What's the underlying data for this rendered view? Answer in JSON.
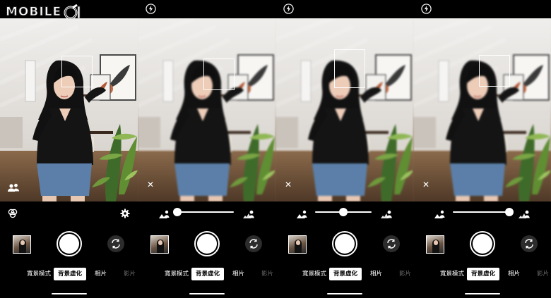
{
  "logo": {
    "text": "MOBILE",
    "mark_icon": "wrench-o1-logo"
  },
  "panels": [
    {
      "id": "panel-0",
      "status": {
        "flash_icon": "flash-auto-icon"
      },
      "viewfinder": {
        "blurred": false,
        "overlay_icon": "people-portrait-icon"
      },
      "controls": {
        "show_slider": false,
        "left_icon": "filter-icon",
        "right_icon": "gear-icon"
      },
      "shutter_icon": "shutter-button",
      "switch_icon": "switch-camera-icon",
      "modes": {
        "portrait": "寬景模式",
        "bokeh": "背景虛化",
        "photo": "相片",
        "video": "影片"
      }
    },
    {
      "id": "panel-1",
      "status": {
        "flash_icon": "flash-auto-icon"
      },
      "viewfinder": {
        "blurred": true,
        "overlay_icon": "close-icon",
        "close_glyph": "✕"
      },
      "controls": {
        "show_slider": true,
        "blur_level": 0.0
      },
      "modes": {
        "portrait": "寬景模式",
        "bokeh": "背景虛化",
        "photo": "相片",
        "video": "影片"
      }
    },
    {
      "id": "panel-2",
      "status": {
        "flash_icon": "flash-auto-icon"
      },
      "viewfinder": {
        "blurred": true,
        "overlay_icon": "close-icon",
        "close_glyph": "✕"
      },
      "controls": {
        "show_slider": true,
        "blur_level": 0.5
      },
      "modes": {
        "portrait": "寬景模式",
        "bokeh": "背景虛化",
        "photo": "相片",
        "video": "影片"
      }
    },
    {
      "id": "panel-3",
      "status": {
        "flash_icon": "flash-auto-icon"
      },
      "viewfinder": {
        "blurred": true,
        "overlay_icon": "close-icon",
        "close_glyph": "✕"
      },
      "controls": {
        "show_slider": true,
        "blur_level": 1.0
      },
      "modes": {
        "portrait": "寬景模式",
        "bokeh": "背景虛化",
        "photo": "相片",
        "video": "影片"
      }
    }
  ],
  "colors": {
    "accent": "#ffffff",
    "background": "#000000",
    "mode_selected_bg": "#ffffff",
    "mode_selected_fg": "#000000"
  }
}
